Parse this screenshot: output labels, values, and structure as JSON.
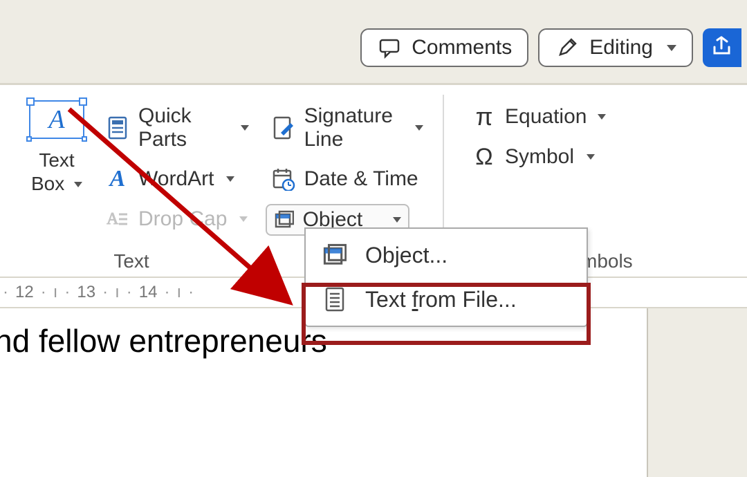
{
  "topbar": {
    "comments_label": "Comments",
    "editing_label": "Editing"
  },
  "ribbon": {
    "text_group": {
      "textbox_label": "Text\nBox",
      "quickparts_label": "Quick Parts",
      "wordart_label": "WordArt",
      "dropcap_label": "Drop Cap",
      "signature_label": "Signature Line",
      "datetime_label": "Date & Time",
      "object_label": "Object",
      "group_title": "Text"
    },
    "symbols_group": {
      "equation_label": "Equation",
      "symbol_label": "Symbol",
      "group_title": "Symbols"
    }
  },
  "dropdown": {
    "object_item": "Object...",
    "text_from_file_prefix": "Text ",
    "text_from_file_u": "f",
    "text_from_file_suffix": "rom File..."
  },
  "ruler": {
    "n12": "12",
    "n13": "13",
    "n14": "14"
  },
  "document": {
    "visible_text": "nd fellow entrepreneurs"
  }
}
